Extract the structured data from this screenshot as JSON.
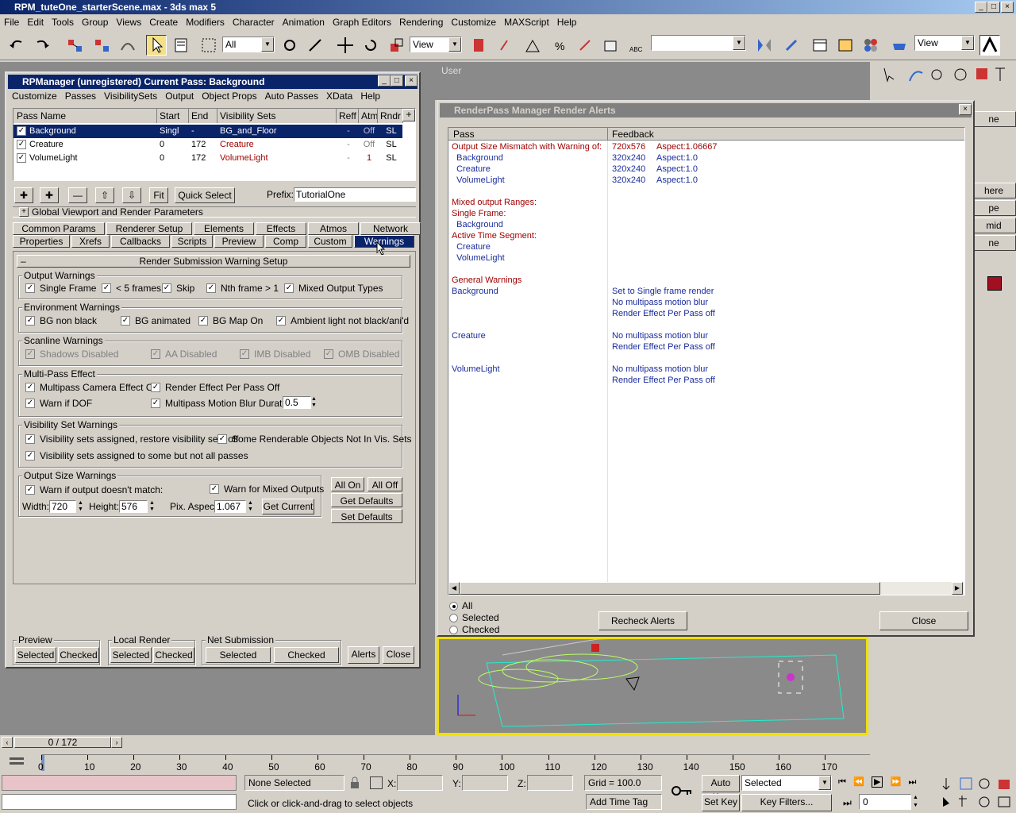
{
  "app": {
    "title": "RPM_tuteOne_starterScene.max - 3ds max 5",
    "menu": [
      "File",
      "Edit",
      "Tools",
      "Group",
      "Views",
      "Create",
      "Modifiers",
      "Character",
      "Animation",
      "Graph Editors",
      "Rendering",
      "Customize",
      "MAXScript",
      "Help"
    ],
    "selection_filter": "All",
    "ref_coord": "View",
    "pivot_view": "View",
    "viewport_label": "User"
  },
  "rpm": {
    "title": "RPManager (unregistered)  Current Pass: Background",
    "menu": [
      "Customize",
      "Passes",
      "VisibilitySets",
      "Output",
      "Object Props",
      "Auto Passes",
      "XData",
      "Help"
    ],
    "columns": [
      "Pass Name",
      "Start",
      "End",
      "Visibility Sets",
      "Reff",
      "Atm",
      "Rndr"
    ],
    "passes": [
      {
        "name": "Background",
        "start": "Singl",
        "end": "-",
        "vis": "BG_and_Floor",
        "reff": "-",
        "atm": "Off",
        "rndr": "SL"
      },
      {
        "name": "Creature",
        "start": "0",
        "end": "172",
        "vis": "Creature",
        "reff": "-",
        "atm": "Off",
        "rndr": "SL"
      },
      {
        "name": "VolumeLight",
        "start": "0",
        "end": "172",
        "vis": "VolumeLight",
        "reff": "-",
        "atm": "1",
        "rndr": "SL"
      }
    ],
    "fit_label": "Fit",
    "quick_select_label": "Quick Select",
    "prefix_label": "Prefix:",
    "prefix_value": "TutorialOne",
    "global_params_label": "Global Viewport and Render Parameters",
    "tabs_row1": [
      "Common Params",
      "Renderer Setup",
      "Elements",
      "Effects",
      "Atmos",
      "Network"
    ],
    "tabs_row2": [
      "Properties",
      "Xrefs",
      "Callbacks",
      "Scripts",
      "Preview",
      "Comp",
      "Custom",
      "Warnings"
    ],
    "rollout_title": "Render Submission Warning Setup",
    "output_warnings": {
      "title": "Output Warnings",
      "items": [
        "Single Frame",
        "< 5 frames",
        "Skip",
        "Nth frame > 1",
        "Mixed Output Types"
      ]
    },
    "env_warnings": {
      "title": "Environment Warnings",
      "items": [
        "BG non black",
        "BG animated",
        "BG Map On",
        "Ambient light not black/ani'd"
      ]
    },
    "scanline_warnings": {
      "title": "Scanline Warnings",
      "items": [
        "Shadows Disabled",
        "AA Disabled",
        "IMB Disabled",
        "OMB Disabled"
      ]
    },
    "multipass": {
      "title": "Multi-Pass Effect",
      "items": [
        "Multipass Camera Effect Off",
        "Render Effect Per Pass Off",
        "Warn if DOF",
        "Multipass Motion Blur Duration:"
      ],
      "duration": "0.5"
    },
    "visset": {
      "title": "Visibility Set Warnings",
      "items": [
        "Visibility sets assigned, restore visibility sets off",
        "Some Renderable Objects Not In Vis. Sets",
        "Visibility sets assigned to some but not all passes"
      ]
    },
    "outsize": {
      "title": "Output Size Warnings",
      "warn_match": "Warn if output doesn't match:",
      "warn_mixed": "Warn for Mixed Outputs",
      "width_label": "Width:",
      "width": "720",
      "height_label": "Height:",
      "height": "576",
      "aspect_label": "Pix. Aspect",
      "aspect": "1.067",
      "get_current": "Get Current"
    },
    "all_on": "All On",
    "all_off": "All Off",
    "get_defaults": "Get Defaults",
    "set_defaults": "Set Defaults",
    "preview": {
      "title": "Preview",
      "selected": "Selected",
      "checked": "Checked"
    },
    "local_render": {
      "title": "Local Render",
      "selected": "Selected",
      "checked": "Checked"
    },
    "net_submission": {
      "title": "Net Submission",
      "selected": "Selected",
      "checked": "Checked"
    },
    "alerts_label": "Alerts",
    "close_label": "Close"
  },
  "alerts": {
    "title": "RenderPass Manager Render Alerts",
    "col_pass": "Pass",
    "col_feedback": "Feedback",
    "rows": [
      {
        "pass": "Output Size Mismatch with Warning of:",
        "pc": "red",
        "fb": "720x576",
        "fb2": "Aspect:1.06667",
        "fc": "red"
      },
      {
        "pass": "  Background",
        "pc": "blue",
        "fb": "320x240",
        "fb2": "Aspect:1.0",
        "fc": "blue"
      },
      {
        "pass": "  Creature",
        "pc": "blue",
        "fb": "320x240",
        "fb2": "Aspect:1.0",
        "fc": "blue"
      },
      {
        "pass": "  VolumeLight",
        "pc": "blue",
        "fb": "320x240",
        "fb2": "Aspect:1.0",
        "fc": "blue"
      },
      {
        "pass": "",
        "pc": "blue",
        "fb": "",
        "fb2": "",
        "fc": "blue"
      },
      {
        "pass": "Mixed output Ranges:",
        "pc": "red",
        "fb": "",
        "fb2": "",
        "fc": "blue"
      },
      {
        "pass": "Single Frame:",
        "pc": "red",
        "fb": "",
        "fb2": "",
        "fc": "blue"
      },
      {
        "pass": "  Background",
        "pc": "blue",
        "fb": "",
        "fb2": "",
        "fc": "blue"
      },
      {
        "pass": "Active Time Segment:",
        "pc": "red",
        "fb": "",
        "fb2": "",
        "fc": "blue"
      },
      {
        "pass": "  Creature",
        "pc": "blue",
        "fb": "",
        "fb2": "",
        "fc": "blue"
      },
      {
        "pass": "  VolumeLight",
        "pc": "blue",
        "fb": "",
        "fb2": "",
        "fc": "blue"
      },
      {
        "pass": "",
        "pc": "blue",
        "fb": "",
        "fb2": "",
        "fc": "blue"
      },
      {
        "pass": "General Warnings",
        "pc": "red",
        "fb": "",
        "fb2": "",
        "fc": "blue"
      },
      {
        "pass": "Background",
        "pc": "blue",
        "fb": "Set to Single frame render",
        "fb2": "",
        "fc": "blue"
      },
      {
        "pass": "",
        "pc": "blue",
        "fb": "No multipass motion blur",
        "fb2": "",
        "fc": "blue"
      },
      {
        "pass": "",
        "pc": "blue",
        "fb": "Render Effect Per Pass off",
        "fb2": "",
        "fc": "blue"
      },
      {
        "pass": "",
        "pc": "blue",
        "fb": "",
        "fb2": "",
        "fc": "blue"
      },
      {
        "pass": "Creature",
        "pc": "blue",
        "fb": "No multipass motion blur",
        "fb2": "",
        "fc": "blue"
      },
      {
        "pass": "",
        "pc": "blue",
        "fb": "Render Effect Per Pass off",
        "fb2": "",
        "fc": "blue"
      },
      {
        "pass": "",
        "pc": "blue",
        "fb": "",
        "fb2": "",
        "fc": "blue"
      },
      {
        "pass": "VolumeLight",
        "pc": "blue",
        "fb": "No multipass motion blur",
        "fb2": "",
        "fc": "blue"
      },
      {
        "pass": "",
        "pc": "blue",
        "fb": "Render Effect Per Pass off",
        "fb2": "",
        "fc": "blue"
      }
    ],
    "radio_all": "All",
    "radio_selected": "Selected",
    "radio_checked": "Checked",
    "recheck_label": "Recheck Alerts",
    "close_label": "Close"
  },
  "cmdpanel": {
    "buttons": [
      "ne",
      "here",
      "pe",
      "mid",
      "ne"
    ]
  },
  "timeline": {
    "slider_label": "0 / 172",
    "ticks": [
      "0",
      "10",
      "20",
      "30",
      "40",
      "50",
      "60",
      "70",
      "80",
      "90",
      "100",
      "110",
      "120",
      "130",
      "140",
      "150",
      "160",
      "170"
    ]
  },
  "status": {
    "selection": "None Selected",
    "x_label": "X:",
    "y_label": "Y:",
    "z_label": "Z:",
    "grid": "Grid = 100.0",
    "auto_key": "Auto Key",
    "key_mode": "Selected",
    "set_key": "Set Key",
    "key_filters": "Key Filters...",
    "frame": "0",
    "prompt": "Click or click-and-drag to select objects",
    "add_time_tag": "Add Time Tag"
  },
  "colors": {
    "accent": "#0a246a",
    "warning_red": "#a00000",
    "info_blue": "#1a2c9c",
    "viewport": "#808080"
  }
}
